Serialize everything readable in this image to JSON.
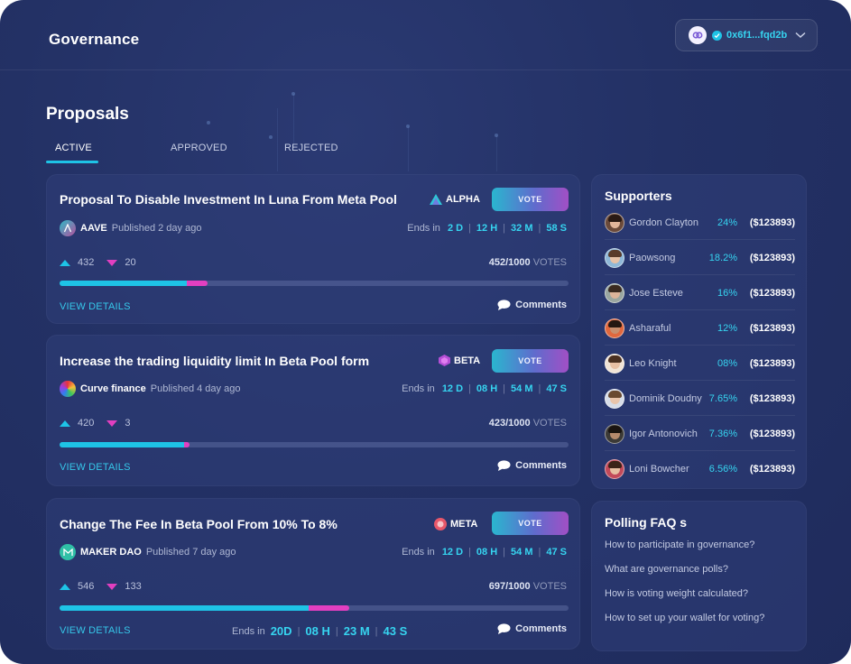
{
  "app": {
    "title": "Governance"
  },
  "wallet": {
    "address": "0x6f1...fqd2b",
    "logo_icon": "link-icon",
    "check_icon": "check-icon"
  },
  "page": {
    "title": "Proposals"
  },
  "tabs": [
    {
      "label": "ACTIVE",
      "active": true
    },
    {
      "label": "APPROVED",
      "active": false
    },
    {
      "label": "REJECTED",
      "active": false
    }
  ],
  "proposals": [
    {
      "title": "Proposal To Disable Investment In Luna From Meta Pool",
      "pool_badge": "ALPHA",
      "vote_label": "VOTE",
      "org": "AAVE",
      "published": "Published 2 day ago",
      "ends_label": "Ends in",
      "ends": [
        "2 D",
        "12 H",
        "32 M",
        "58 S"
      ],
      "up_votes": "432",
      "down_votes": "20",
      "tally": "452/1000",
      "tally_unit": "VOTES",
      "up_fraction": 0.25,
      "down_fraction": 0.04,
      "view_details": "VIEW DETAILS",
      "comments": "Comments"
    },
    {
      "title": "Increase the trading liquidity limit In Beta Pool form",
      "pool_badge": "BETA",
      "vote_label": "VOTE",
      "org": "Curve finance",
      "published": "Published 4 day ago",
      "ends_label": "Ends in",
      "ends": [
        "12 D",
        "08 H",
        "54 M",
        "47 S"
      ],
      "up_votes": "420",
      "down_votes": "3",
      "tally": "423/1000",
      "tally_unit": "VOTES",
      "up_fraction": 0.245,
      "down_fraction": 0.01,
      "view_details": "VIEW DETAILS",
      "comments": "Comments"
    },
    {
      "title": "Change The Fee In Beta Pool From 10% To 8%",
      "pool_badge": "META",
      "vote_label": "VOTE",
      "org": "MAKER DAO",
      "published": "Published 7 day ago",
      "ends_label": "Ends in",
      "ends": [
        "12 D",
        "08 H",
        "54 M",
        "47 S"
      ],
      "up_votes": "546",
      "down_votes": "133",
      "tally": "697/1000",
      "tally_unit": "VOTES",
      "up_fraction": 0.49,
      "down_fraction": 0.08,
      "view_details": "VIEW DETAILS",
      "comments": "Comments",
      "bottom_ends_label": "Ends in",
      "bottom_ends": [
        "20D",
        "08 H",
        "23 M",
        "43 S"
      ]
    }
  ],
  "supporters": {
    "title": "Supporters",
    "items": [
      {
        "name": "Gordon Clayton",
        "pct": "24%",
        "amount": "($123893)"
      },
      {
        "name": "Paowsong",
        "pct": "18.2%",
        "amount": "($123893)"
      },
      {
        "name": "Jose Esteve",
        "pct": "16%",
        "amount": "($123893)"
      },
      {
        "name": "Asharaful",
        "pct": "12%",
        "amount": "($123893)"
      },
      {
        "name": "Leo Knight",
        "pct": "08%",
        "amount": "($123893)"
      },
      {
        "name": "Dominik Doudny",
        "pct": "7.65%",
        "amount": "($123893)"
      },
      {
        "name": "Igor Antonovich",
        "pct": "7.36%",
        "amount": "($123893)"
      },
      {
        "name": "Loni Bowcher",
        "pct": "6.56%",
        "amount": "($123893)"
      }
    ]
  },
  "faq": {
    "title": "Polling FAQ s",
    "items": [
      "How to participate in  governance?",
      "What are governance polls?",
      "How is voting weight calculated?",
      "How to set up your wallet for voting?"
    ]
  },
  "colors": {
    "accent": "#1ec3e6",
    "down": "#e23fc0",
    "background": "#233165"
  }
}
